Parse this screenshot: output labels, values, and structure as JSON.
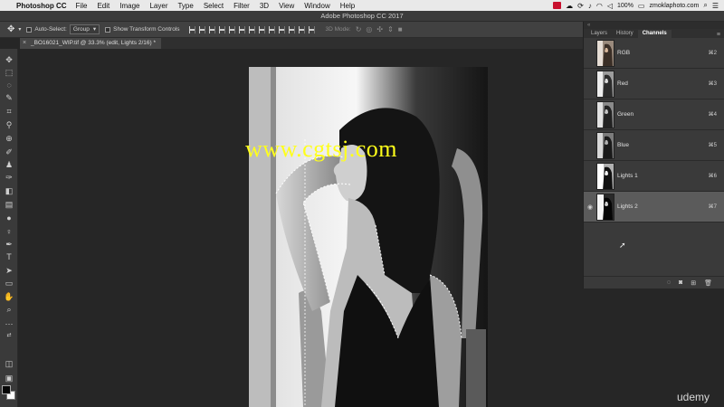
{
  "menubar": {
    "apple": "",
    "app_name": "Photoshop CC",
    "items": [
      "File",
      "Edit",
      "Image",
      "Layer",
      "Type",
      "Select",
      "Filter",
      "3D",
      "View",
      "Window",
      "Help"
    ],
    "battery": "100%",
    "user": "zmoklaphoto.com"
  },
  "window": {
    "title": "Adobe Photoshop CC 2017"
  },
  "options": {
    "auto_select_label": "Auto-Select:",
    "auto_select_value": "Group",
    "show_transform_label": "Show Transform Controls",
    "mode3d_label": "3D Mode:"
  },
  "document": {
    "tab_title": "_BO16021_WIP.tif @ 33.3% (edit, Lights 2/16) *"
  },
  "panel": {
    "tabs": [
      "Layers",
      "History",
      "Channels"
    ],
    "active_tab": "Channels",
    "channels": [
      {
        "name": "RGB",
        "shortcut": "⌘2",
        "visible": false,
        "selected": false
      },
      {
        "name": "Red",
        "shortcut": "⌘3",
        "visible": false,
        "selected": false
      },
      {
        "name": "Green",
        "shortcut": "⌘4",
        "visible": false,
        "selected": false
      },
      {
        "name": "Blue",
        "shortcut": "⌘5",
        "visible": false,
        "selected": false
      },
      {
        "name": "Lights 1",
        "shortcut": "⌘6",
        "visible": false,
        "selected": false
      },
      {
        "name": "Lights 2",
        "shortcut": "⌘7",
        "visible": true,
        "selected": true
      }
    ]
  },
  "overlay": {
    "watermark": "www.cgtsj.com",
    "brand": "udemy"
  },
  "colors": {
    "watermark": "#ffff1a",
    "selected_row": "#5b5b5b",
    "rec_indicator": "#c8102e"
  }
}
